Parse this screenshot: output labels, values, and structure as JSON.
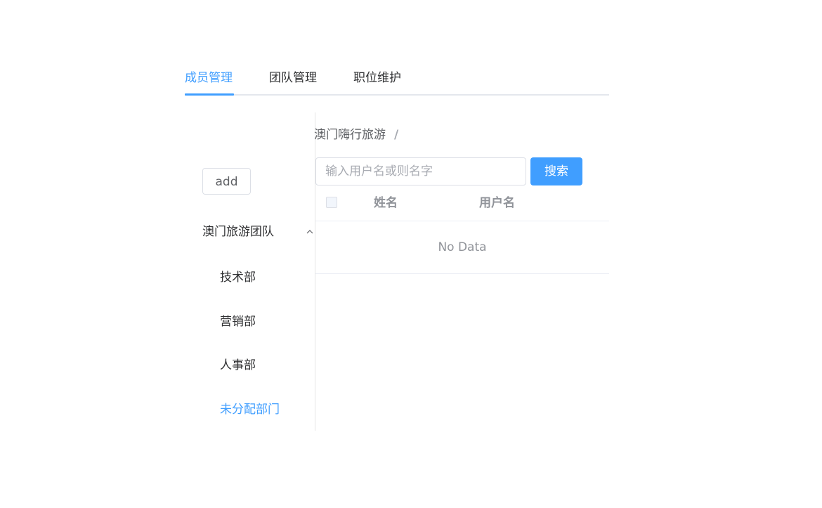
{
  "tabs": [
    {
      "label": "成员管理",
      "active": true
    },
    {
      "label": "团队管理",
      "active": false
    },
    {
      "label": "职位维护",
      "active": false
    }
  ],
  "sidebar": {
    "add_label": "add",
    "group": {
      "label": "澳门旅游团队",
      "expanded": true,
      "icon": "chevron-up-icon"
    },
    "items": [
      {
        "label": "技术部",
        "active": false
      },
      {
        "label": "营销部",
        "active": false
      },
      {
        "label": "人事部",
        "active": false
      },
      {
        "label": "未分配部门",
        "active": true
      }
    ]
  },
  "breadcrumb": {
    "current": "澳门嗨行旅游",
    "separator": "/"
  },
  "search": {
    "placeholder": "输入用户名或则名字",
    "value": "",
    "button_label": "搜索"
  },
  "table": {
    "columns": [
      "姓名",
      "用户名"
    ],
    "empty_text": "No Data"
  },
  "colors": {
    "accent": "#409eff",
    "text": "#303133",
    "muted": "#909399",
    "border": "#dcdfe6"
  }
}
